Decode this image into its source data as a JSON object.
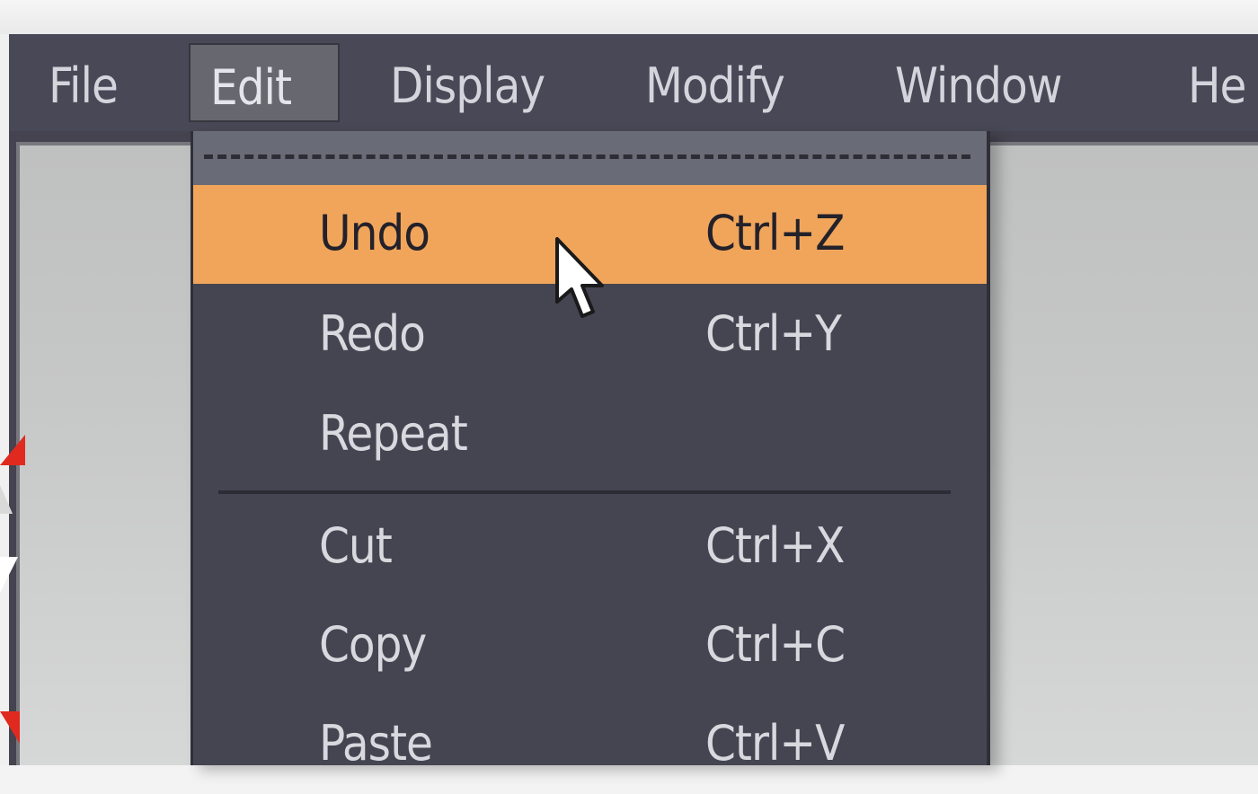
{
  "menubar": {
    "items": [
      {
        "label": "File"
      },
      {
        "label": "Edit"
      },
      {
        "label": "Display"
      },
      {
        "label": "Modify"
      },
      {
        "label": "Window"
      },
      {
        "label": "He"
      }
    ],
    "active": "Edit"
  },
  "edit_menu": {
    "items": [
      {
        "label": "Undo",
        "shortcut": "Ctrl+Z",
        "highlighted": true
      },
      {
        "label": "Redo",
        "shortcut": "Ctrl+Y"
      },
      {
        "label": "Repeat",
        "shortcut": ""
      },
      {
        "label": "Cut",
        "shortcut": "Ctrl+X"
      },
      {
        "label": "Copy",
        "shortcut": "Ctrl+C"
      },
      {
        "label": "Paste",
        "shortcut": "Ctrl+V"
      }
    ]
  },
  "colors": {
    "highlight": "#f0a55a",
    "menubar": "#484856",
    "menu_background": "#454552",
    "text": "#d8d9de"
  },
  "icons": {
    "cursor": "arrow-pointer-icon"
  }
}
